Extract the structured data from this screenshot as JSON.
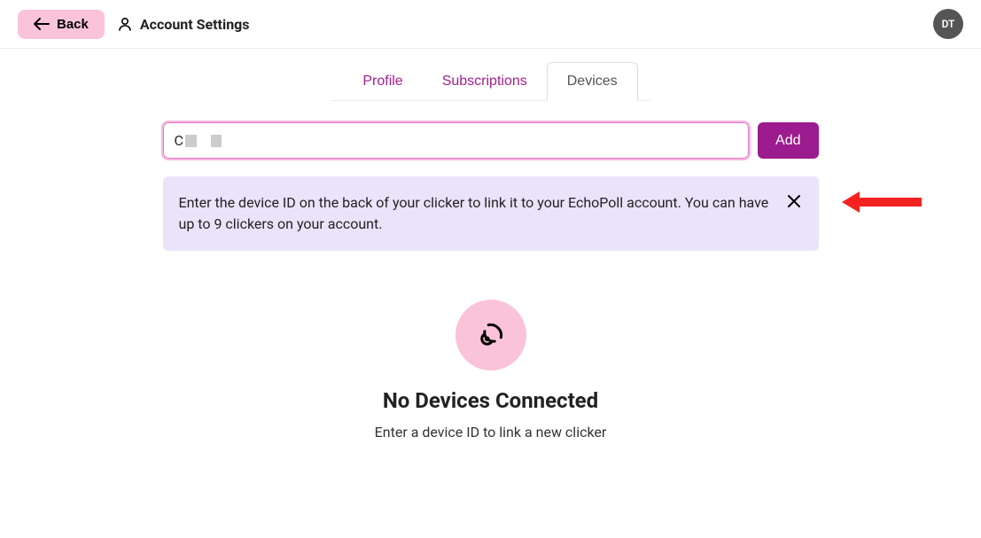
{
  "header": {
    "back_label": "Back",
    "page_title": "Account Settings",
    "avatar_initials": "DT"
  },
  "tabs": {
    "profile": "Profile",
    "subscriptions": "Subscriptions",
    "devices": "Devices"
  },
  "input": {
    "prefix": "C",
    "add_label": "Add"
  },
  "banner": {
    "text": "Enter the device ID on the back of your clicker to link it to your EchoPoll account. You can have up to 9 clickers on your account."
  },
  "empty": {
    "title": "No Devices Connected",
    "subtitle": "Enter a device ID to link a new clicker"
  }
}
